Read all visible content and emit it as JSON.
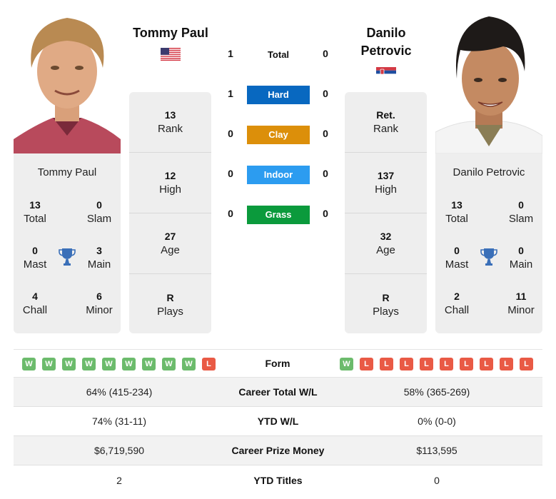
{
  "player1": {
    "name": "Tommy Paul",
    "country_flag": "usa-flag",
    "stats": [
      {
        "value": "13",
        "label": "Rank"
      },
      {
        "value": "12",
        "label": "High"
      },
      {
        "value": "27",
        "label": "Age"
      },
      {
        "value": "R",
        "label": "Plays"
      }
    ],
    "titles": {
      "name": "Tommy Paul",
      "total": {
        "value": "13",
        "label": "Total"
      },
      "slam": {
        "value": "0",
        "label": "Slam"
      },
      "mast": {
        "value": "0",
        "label": "Mast"
      },
      "main": {
        "value": "3",
        "label": "Main"
      },
      "chall": {
        "value": "4",
        "label": "Chall"
      },
      "minor": {
        "value": "6",
        "label": "Minor"
      }
    },
    "form": [
      "W",
      "W",
      "W",
      "W",
      "W",
      "W",
      "W",
      "W",
      "W",
      "L"
    ]
  },
  "player2": {
    "name": "Danilo Petrovic",
    "country_flag": "serbia-flag",
    "stats": [
      {
        "value": "Ret.",
        "label": "Rank"
      },
      {
        "value": "137",
        "label": "High"
      },
      {
        "value": "32",
        "label": "Age"
      },
      {
        "value": "R",
        "label": "Plays"
      }
    ],
    "titles": {
      "name": "Danilo Petrovic",
      "total": {
        "value": "13",
        "label": "Total"
      },
      "slam": {
        "value": "0",
        "label": "Slam"
      },
      "mast": {
        "value": "0",
        "label": "Mast"
      },
      "main": {
        "value": "0",
        "label": "Main"
      },
      "chall": {
        "value": "2",
        "label": "Chall"
      },
      "minor": {
        "value": "11",
        "label": "Minor"
      }
    },
    "form": [
      "W",
      "L",
      "L",
      "L",
      "L",
      "L",
      "L",
      "L",
      "L",
      "L"
    ]
  },
  "h2h": [
    {
      "label": "Total",
      "p1": "1",
      "p2": "0",
      "color": null
    },
    {
      "label": "Hard",
      "p1": "1",
      "p2": "0",
      "color": "#0868c0"
    },
    {
      "label": "Clay",
      "p1": "0",
      "p2": "0",
      "color": "#dc8f0a"
    },
    {
      "label": "Indoor",
      "p1": "0",
      "p2": "0",
      "color": "#2c9cf0"
    },
    {
      "label": "Grass",
      "p1": "0",
      "p2": "0",
      "color": "#0b9a3c"
    }
  ],
  "form_label": "Form",
  "comparison": [
    {
      "label": "Career Total W/L",
      "p1": "64% (415-234)",
      "p2": "58% (365-269)"
    },
    {
      "label": "YTD W/L",
      "p1": "74% (31-11)",
      "p2": "0% (0-0)"
    },
    {
      "label": "Career Prize Money",
      "p1": "$6,719,590",
      "p2": "$113,595"
    },
    {
      "label": "YTD Titles",
      "p1": "2",
      "p2": "0"
    }
  ],
  "colors": {
    "win": "#6cbb6c",
    "loss": "#e95a45",
    "trophy": "#3a6fb8",
    "panel": "#eeeeee"
  }
}
